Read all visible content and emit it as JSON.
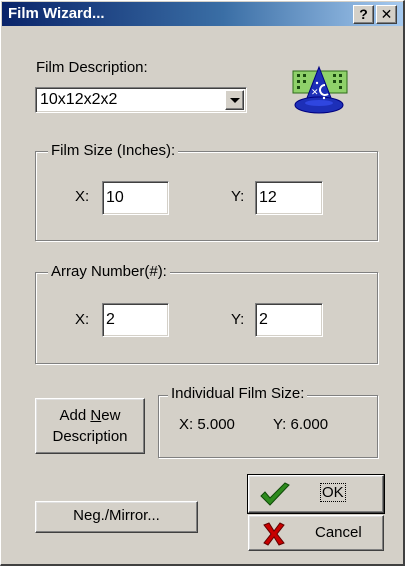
{
  "window": {
    "title": "Film Wizard...",
    "help_label": "?",
    "close_label": "✕"
  },
  "film_description": {
    "label": "Film Description:",
    "selected": "10x12x2x2"
  },
  "film_size": {
    "group_title": "Film Size (Inches):",
    "x_label": "X:",
    "x_value": "10",
    "y_label": "Y:",
    "y_value": "12"
  },
  "array_number": {
    "group_title": "Array Number(#):",
    "x_label": "X:",
    "x_value": "2",
    "y_label": "Y:",
    "y_value": "2"
  },
  "add_description": {
    "line1_pre": "Add ",
    "line1_key": "N",
    "line1_post": "ew",
    "line2": "Description"
  },
  "individual_film_size": {
    "group_title": "Individual Film Size:",
    "x_text": "X: 5.000",
    "y_text": "Y: 6.000"
  },
  "buttons": {
    "neg_mirror": "Neg./Mirror...",
    "ok": "OK",
    "cancel": "Cancel"
  },
  "icons": {
    "wizard": "wizard-hat-icon",
    "ok": "checkmark-icon",
    "cancel": "red-x-icon"
  },
  "colors": {
    "titlebar_start": "#0a246a",
    "titlebar_end": "#a6caf0",
    "face": "#d4d0c8",
    "check_green": "#2e8b1e",
    "cancel_red": "#c80000"
  }
}
